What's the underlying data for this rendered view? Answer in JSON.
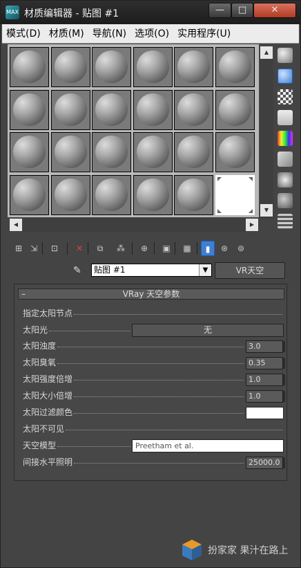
{
  "window": {
    "title": "材质编辑器 - 贴图 #1",
    "app_icon_text": "MAX",
    "minimize_label": "—",
    "maximize_label": "□",
    "close_label": "✕"
  },
  "menubar": {
    "items": [
      {
        "label": "模式(D)"
      },
      {
        "label": "材质(M)"
      },
      {
        "label": "导航(N)"
      },
      {
        "label": "选项(O)"
      },
      {
        "label": "实用程序(U)"
      }
    ]
  },
  "sample_slots": {
    "rows": 4,
    "columns": 6,
    "selected_slot": 24
  },
  "scrollbars": {
    "up": "▲",
    "down": "▼",
    "left": "◀",
    "right": "▶"
  },
  "toolbar_icons": [
    "get-material-icon",
    "put-to-scene-icon",
    "assign-to-selection-icon",
    "reset-map-icon",
    "make-copy-icon",
    "make-unique-icon",
    "put-to-library-icon",
    "material-id-icon",
    "show-shaded-icon",
    "show-end-result-icon",
    "go-to-parent-icon",
    "go-forward-icon"
  ],
  "map_selector": {
    "value": "贴图 #1",
    "type_button": "VR天空"
  },
  "rollout": {
    "title": "VRay 天空参数",
    "collapse_symbol": "–",
    "params": [
      {
        "label": "指定太阳节点",
        "kind": "check"
      },
      {
        "label": "太阳光",
        "kind": "button",
        "value": "无"
      },
      {
        "label": "太阳浊度",
        "kind": "spinner",
        "value": "3.0"
      },
      {
        "label": "太阳臭氧",
        "kind": "spinner",
        "value": "0.35"
      },
      {
        "label": "太阳强度倍增",
        "kind": "spinner",
        "value": "1.0"
      },
      {
        "label": "太阳大小倍增",
        "kind": "spinner",
        "value": "1.0"
      },
      {
        "label": "太阳过滤颜色",
        "kind": "color",
        "value": "#ffffff"
      },
      {
        "label": "太阳不可见",
        "kind": "check"
      },
      {
        "label": "天空模型",
        "kind": "dropdown",
        "value": "Preetham et al."
      },
      {
        "label": "间接水平照明",
        "kind": "spinner",
        "value": "25000.0"
      }
    ]
  },
  "watermark": {
    "brand": "扮家家",
    "text": "果汁在路上"
  },
  "colors": {
    "window_bg": "#444444",
    "menubar_bg": "#ececec",
    "close_button": "#c4523c",
    "active_tool": "#3f7fd2"
  }
}
